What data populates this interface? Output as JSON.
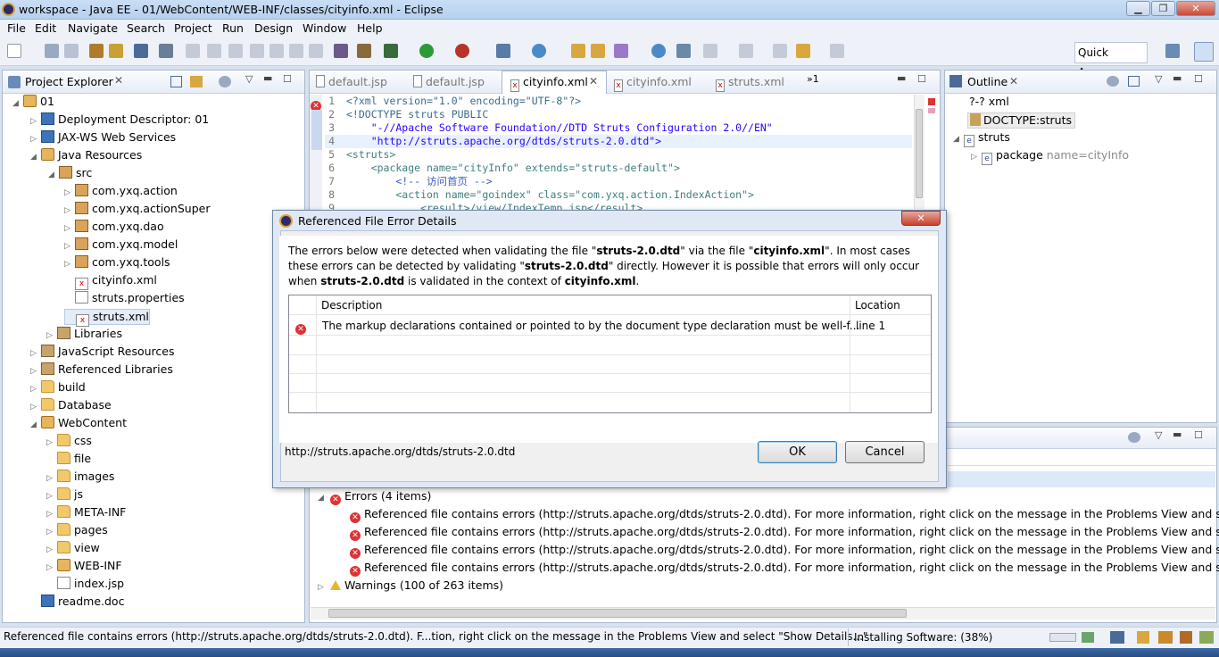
{
  "window": {
    "title": "workspace - Java EE - 01/WebContent/WEB-INF/classes/cityinfo.xml - Eclipse"
  },
  "menu": [
    "File",
    "Edit",
    "Navigate",
    "Search",
    "Project",
    "Run",
    "Design",
    "Window",
    "Help"
  ],
  "toolbar": {
    "quick_access": "Quick Access"
  },
  "explorer": {
    "title": "Project Explorer",
    "items": [
      {
        "label": "01",
        "icon": "project-icon"
      },
      {
        "label": "Deployment Descriptor: 01",
        "icon": "descriptor-icon"
      },
      {
        "label": "JAX-WS Web Services",
        "icon": "webservice-icon"
      },
      {
        "label": "Java Resources",
        "icon": "java-resources-icon"
      },
      {
        "label": "src",
        "icon": "source-folder-icon"
      },
      {
        "label": "com.yxq.action",
        "icon": "package-icon"
      },
      {
        "label": "com.yxq.actionSuper",
        "icon": "package-icon"
      },
      {
        "label": "com.yxq.dao",
        "icon": "package-icon"
      },
      {
        "label": "com.yxq.model",
        "icon": "package-icon"
      },
      {
        "label": "com.yxq.tools",
        "icon": "package-icon"
      },
      {
        "label": "cityinfo.xml",
        "icon": "xml-error-icon"
      },
      {
        "label": "struts.properties",
        "icon": "file-icon"
      },
      {
        "label": "struts.xml",
        "icon": "xml-error-icon"
      },
      {
        "label": "Libraries",
        "icon": "library-icon"
      },
      {
        "label": "JavaScript Resources",
        "icon": "js-resources-icon"
      },
      {
        "label": "Referenced Libraries",
        "icon": "library-icon"
      },
      {
        "label": "build",
        "icon": "folder-icon"
      },
      {
        "label": "Database",
        "icon": "folder-icon"
      },
      {
        "label": "WebContent",
        "icon": "webcontent-icon"
      },
      {
        "label": "css",
        "icon": "folder-icon"
      },
      {
        "label": "file",
        "icon": "folder-icon"
      },
      {
        "label": "images",
        "icon": "folder-icon"
      },
      {
        "label": "js",
        "icon": "folder-icon"
      },
      {
        "label": "META-INF",
        "icon": "folder-icon"
      },
      {
        "label": "pages",
        "icon": "folder-icon"
      },
      {
        "label": "view",
        "icon": "folder-icon"
      },
      {
        "label": "WEB-INF",
        "icon": "folder-icon"
      },
      {
        "label": "index.jsp",
        "icon": "file-icon"
      },
      {
        "label": "readme.doc",
        "icon": "doc-icon"
      }
    ]
  },
  "editor": {
    "tabs": [
      "default.jsp",
      "default.jsp",
      "cityinfo.xml",
      "cityinfo.xml",
      "struts.xml"
    ],
    "overflow": "»1",
    "line_numbers": [
      "1",
      "2",
      "3",
      "4",
      "5",
      "6",
      "7",
      "8",
      "9"
    ],
    "lines": [
      "<?xml version=\"1.0\" encoding=\"UTF-8\"?>",
      "<!DOCTYPE struts PUBLIC",
      "    \"-//Apache Software Foundation//DTD Struts Configuration 2.0//EN\"",
      "    \"http://struts.apache.org/dtds/struts-2.0.dtd\">",
      "<struts>",
      "    <package name=\"cityInfo\" extends=\"struts-default\">",
      "        <!-- 访问首页 -->",
      "        <action name=\"goindex\" class=\"com.yxq.action.IndexAction\">",
      "            <result>/view/IndexTemp.jsp</result>"
    ]
  },
  "outline": {
    "title": "Outline",
    "items": [
      "?-? xml",
      "DOCTYPE:struts",
      "struts",
      "package",
      "name=cityInfo"
    ]
  },
  "problems": {
    "errors_label": "Errors (4 items)",
    "error_rows": [
      "Referenced file contains errors (http://struts.apache.org/dtds/struts-2.0.dtd).  For more information, right click on the message in the Problems View and select \"Sh",
      "Referenced file contains errors (http://struts.apache.org/dtds/struts-2.0.dtd).  For more information, right click on the message in the Problems View and select \"Sh",
      "Referenced file contains errors (http://struts.apache.org/dtds/struts-2.0.dtd).  For more information, right click on the message in the Problems View and select \"Sh",
      "Referenced file contains errors (http://struts.apache.org/dtds/struts-2.0.dtd).  For more information, right click on the message in the Problems View and select \"Sh"
    ],
    "warnings_label": "Warnings (100 of 263 items)"
  },
  "dialog": {
    "title": "Referenced File Error Details",
    "msg_1": "The errors below were detected when validating the file \"",
    "file_dtd": "struts-2.0.dtd",
    "msg_2": "\" via the file \"",
    "file_xml": "cityinfo.xml",
    "msg_3": "\".  In most cases these errors can be detected by validating \"",
    "msg_4": "\" directly.  However it is possible that errors will only occur when ",
    "msg_5": " is validated in the context of ",
    "msg_6": ".",
    "col_description": "Description",
    "col_location": "Location",
    "row_description": "The markup declarations contained or pointed to by the document type declaration must be well-f...",
    "row_location": "line 1",
    "url": "http://struts.apache.org/dtds/struts-2.0.dtd",
    "ok": "OK",
    "cancel": "Cancel"
  },
  "status": {
    "message": "Referenced file contains errors (http://struts.apache.org/dtds/struts-2.0.dtd).  F...tion, right click on the message in the Problems View and select \"Show Details...\"",
    "progress": "Installing Software: (38%)"
  }
}
